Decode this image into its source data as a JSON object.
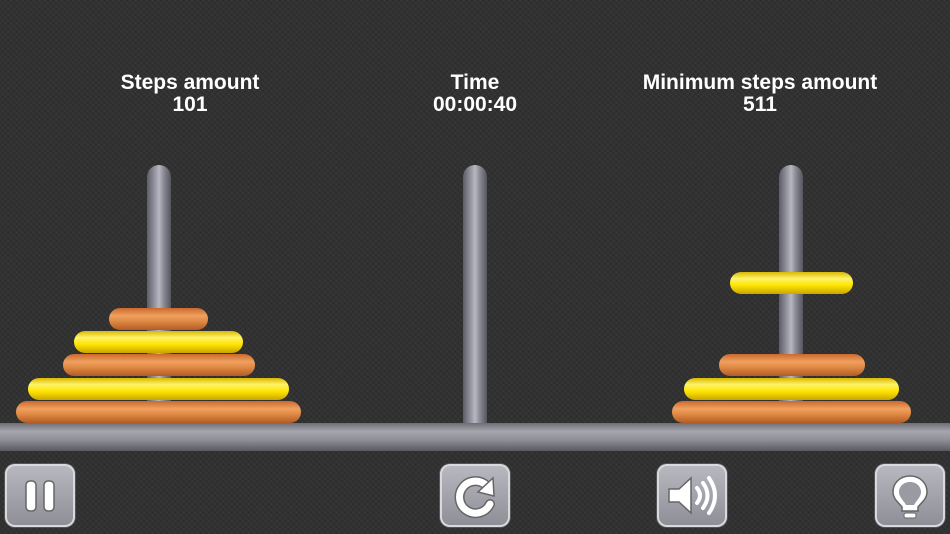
{
  "stats": {
    "steps": {
      "label": "Steps amount",
      "value": "101"
    },
    "time": {
      "label": "Time",
      "value": "00:00:40"
    },
    "minimum": {
      "label": "Minimum steps amount",
      "value": "511"
    }
  },
  "rods": [
    {
      "name": "left",
      "disks": [
        "orange",
        "yellow",
        "orange",
        "yellow",
        "orange"
      ]
    },
    {
      "name": "middle",
      "disks": []
    },
    {
      "name": "right",
      "disks": [
        "orange",
        "yellow",
        "orange"
      ],
      "lifted": "yellow"
    }
  ],
  "buttons": [
    {
      "name": "pause-button",
      "icon": "pause-icon"
    },
    {
      "name": "restart-button",
      "icon": "restart-icon"
    },
    {
      "name": "sound-button",
      "icon": "speaker-icon"
    },
    {
      "name": "hint-button",
      "icon": "lightbulb-icon"
    }
  ],
  "colors": {
    "disk_orange": "#e08a45",
    "disk_yellow": "#ffe500",
    "background": "#2f2f2f"
  }
}
